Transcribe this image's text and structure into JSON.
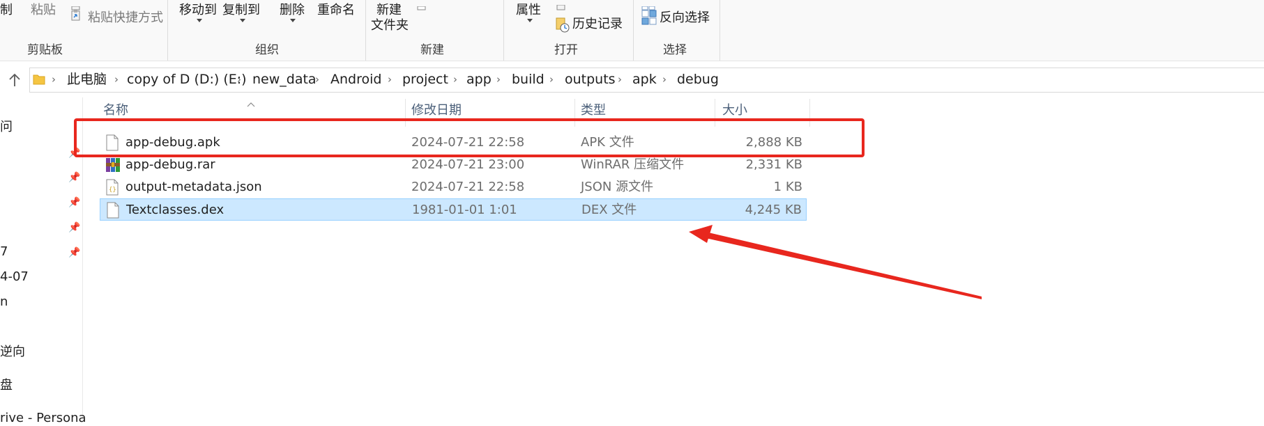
{
  "ribbon": {
    "clipboard": {
      "copy_label": "制",
      "paste_label": "粘贴",
      "paste_shortcut_label": "粘贴快捷方式",
      "group_label": "剪贴板"
    },
    "organize": {
      "move_to_label": "移动到",
      "copy_to_label": "复制到",
      "delete_label": "删除",
      "rename_label": "重命名",
      "group_label": "组织"
    },
    "new": {
      "new_folder_line1": "新建",
      "new_folder_line2": "文件夹",
      "group_label": "新建"
    },
    "open": {
      "properties_label": "属性",
      "history_label": "历史记录",
      "group_label": "打开"
    },
    "select": {
      "invert_selection_label": "反向选择",
      "group_label": "选择"
    }
  },
  "address_bar": {
    "breadcrumbs": [
      "此电脑",
      "copy of D (D:) (E:)",
      "new_data",
      "Android",
      "project",
      "app",
      "build",
      "outputs",
      "apk",
      "debug"
    ]
  },
  "nav_pane": {
    "items": [
      "问",
      "7",
      "4-07",
      "n",
      "逆向",
      "盘",
      "rive - Persona"
    ]
  },
  "columns": {
    "name": "名称",
    "date": "修改日期",
    "type": "类型",
    "size": "大小"
  },
  "files": [
    {
      "name": "app-debug.apk",
      "date": "2024-07-21 22:58",
      "type": "APK 文件",
      "size": "2,888 KB",
      "icon": "file-icon",
      "selected": false
    },
    {
      "name": "app-debug.rar",
      "date": "2024-07-21 23:00",
      "type": "WinRAR 压缩文件",
      "size": "2,331 KB",
      "icon": "winrar-icon",
      "selected": false
    },
    {
      "name": "output-metadata.json",
      "date": "2024-07-21 22:58",
      "type": "JSON 源文件",
      "size": "1 KB",
      "icon": "json-file-icon",
      "selected": false
    },
    {
      "name": "Textclasses.dex",
      "date": "1981-01-01 1:01",
      "type": "DEX 文件",
      "size": "4,245 KB",
      "icon": "file-icon",
      "selected": true
    }
  ],
  "annotation_color": "#e8271e",
  "selection_color": "#cce8ff"
}
